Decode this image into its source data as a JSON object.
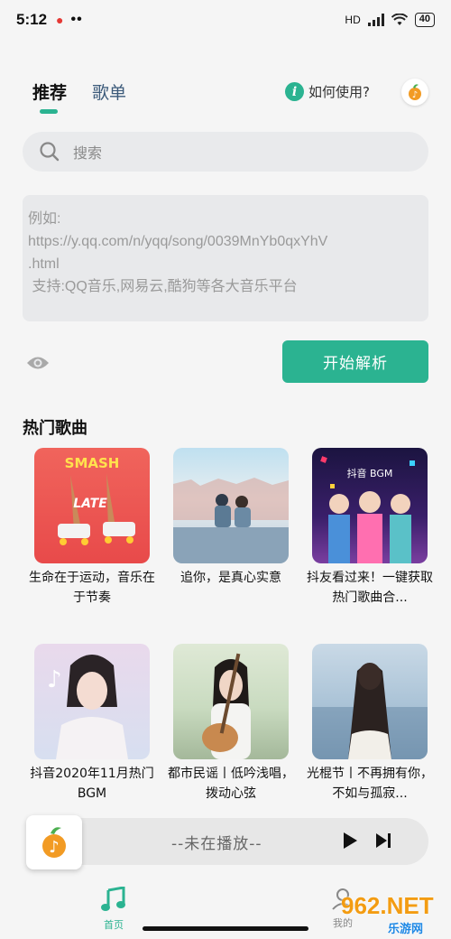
{
  "status": {
    "time": "5:12",
    "dots": "••",
    "hd": "HD",
    "battery": "40"
  },
  "tabs": [
    {
      "label": "推荐",
      "active": true
    },
    {
      "label": "歌单",
      "active": false
    }
  ],
  "help": {
    "icon": "i",
    "label": "如何使用?"
  },
  "search": {
    "placeholder": "搜索"
  },
  "url_box": {
    "example": "例如:\nhttps://y.qq.com/n/yqq/song/0039MnYb0qxYhV\n.html\n 支持:QQ音乐,网易云,酷狗等各大音乐平台"
  },
  "actions": {
    "parse_label": "开始解析"
  },
  "section": {
    "hot_title": "热门歌曲"
  },
  "songs": [
    {
      "title": "生命在于运动，音乐在于节奏",
      "cover_text": "SMASH"
    },
    {
      "title": "追你，是真心实意",
      "cover_text": ""
    },
    {
      "title": "抖友看过来！一键获取热门歌曲合...",
      "cover_text": "抖音 BGM"
    },
    {
      "title": "抖音2020年11月热门BGM",
      "cover_text": ""
    },
    {
      "title": "都市民谣丨低吟浅唱，拨动心弦",
      "cover_text": ""
    },
    {
      "title": "光棍节丨不再拥有你，不如与孤寂...",
      "cover_text": ""
    }
  ],
  "player": {
    "status_text": "--未在播放--"
  },
  "nav": {
    "home_label": "首页",
    "mine_label": "我的"
  },
  "watermark": {
    "brand": "962.NET",
    "sub": "乐游网"
  },
  "colors": {
    "accent": "#2bb391",
    "background": "#f5f5f5"
  }
}
